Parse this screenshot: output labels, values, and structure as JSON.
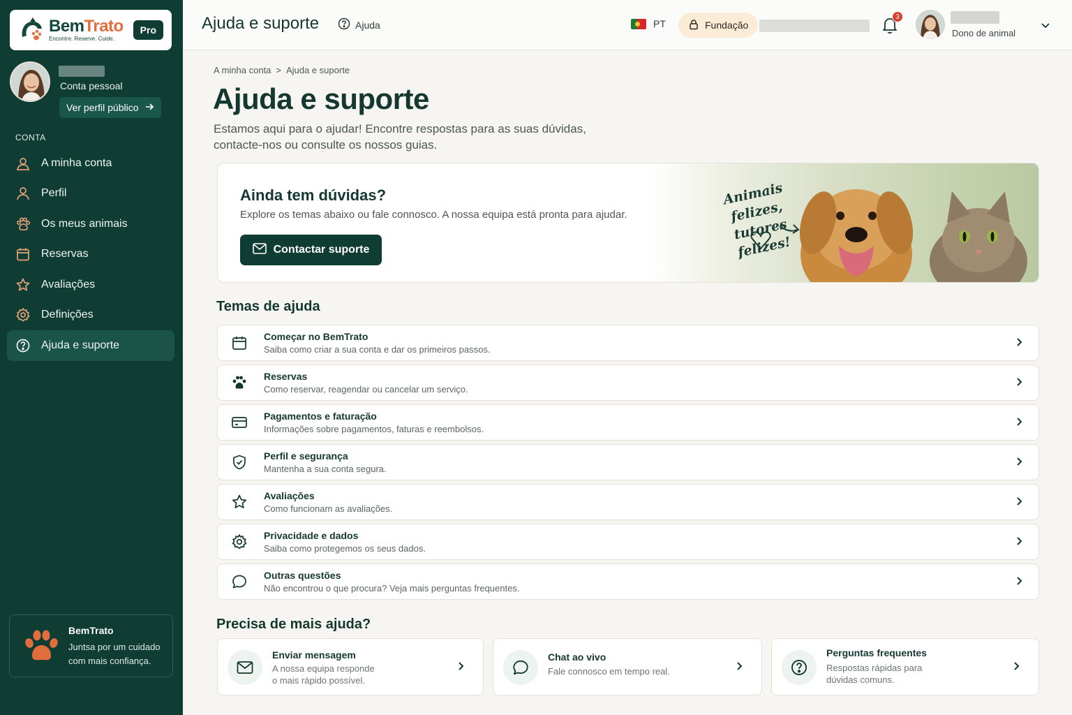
{
  "brand": {
    "name_part1": "Bem",
    "name_part2": "Trato",
    "tagline": "Encontre. Reserve. Cuide.",
    "badge": "Pro",
    "colors": {
      "primary": "#0f3d34",
      "accent": "#e26d3d"
    }
  },
  "sidebar": {
    "account_type": "Conta pessoal",
    "profile_link": "Ver perfil público",
    "section_label": "CONTA",
    "items": [
      {
        "label": "A minha conta",
        "icon": "user-circle-icon"
      },
      {
        "label": "Perfil",
        "icon": "user-icon"
      },
      {
        "label": "Os meus animais",
        "icon": "paw-icon"
      },
      {
        "label": "Reservas",
        "icon": "calendar-icon"
      },
      {
        "label": "Avaliações",
        "icon": "star-icon"
      },
      {
        "label": "Definições",
        "icon": "gear-icon"
      },
      {
        "label": "Ajuda e suporte",
        "icon": "help-circle-icon",
        "active": true
      }
    ],
    "promo": {
      "title": "BemTrato",
      "text": "Juntsa por um cuidado com mais confiança."
    }
  },
  "topbar": {
    "title": "Ajuda e suporte",
    "help": "Ajuda",
    "language": "PT",
    "foundation": "Fundação",
    "notifications": "3",
    "user_role": "Dono de animal"
  },
  "breadcrumb": {
    "item1": "A minha conta",
    "separator": ">",
    "item2": "Ajuda e suporte"
  },
  "page": {
    "title": "Ajuda e suporte",
    "subtitle": "Estamos aqui para o ajudar! Encontre respostas para as suas dúvidas, contacte-nos ou consulte os nossos guias."
  },
  "hero": {
    "title": "Ainda tem dúvidas?",
    "text": "Explore os temas abaixo ou fale connosco. A nossa equipa está pronta para ajudar.",
    "button": "Contactar suporte",
    "slogan": "Animais felizes, tutores felizes!"
  },
  "topics_title": "Temas de ajuda",
  "topics": [
    {
      "title": "Começar no BemTrato",
      "desc": "Saiba como criar a sua conta e dar os primeiros passos.",
      "icon": "calendar-icon"
    },
    {
      "title": "Reservas",
      "desc": "Como reservar, reagendar ou cancelar um serviço.",
      "icon": "paw-icon"
    },
    {
      "title": "Pagamentos e faturação",
      "desc": "Informações sobre pagamentos, faturas e reembolsos.",
      "icon": "credit-card-icon"
    },
    {
      "title": "Perfil e segurança",
      "desc": "Mantenha a sua conta segura.",
      "icon": "shield-icon"
    },
    {
      "title": "Avaliações",
      "desc": "Como funcionam as avaliações.",
      "icon": "star-icon"
    },
    {
      "title": "Privacidade e dados",
      "desc": "Saiba como protegemos os seus dados.",
      "icon": "gear-icon"
    },
    {
      "title": "Outras questões",
      "desc": "Não encontrou o que procura? Veja mais perguntas frequentes.",
      "icon": "chat-bubble-icon"
    }
  ],
  "more_help_title": "Precisa de mais ajuda?",
  "cards": [
    {
      "title": "Enviar mensagem",
      "desc1": "A nossa equipa responde",
      "desc2": "o mais rápido possível.",
      "icon": "mail-icon"
    },
    {
      "title": "Chat ao vivo",
      "desc1": "Fale connosco em tempo real.",
      "desc2": "",
      "icon": "chat-bubble-icon"
    },
    {
      "title": "Perguntas frequentes",
      "desc1": "Respostas rápidas para",
      "desc2": "dúvidas comuns.",
      "icon": "help-circle-icon"
    }
  ]
}
